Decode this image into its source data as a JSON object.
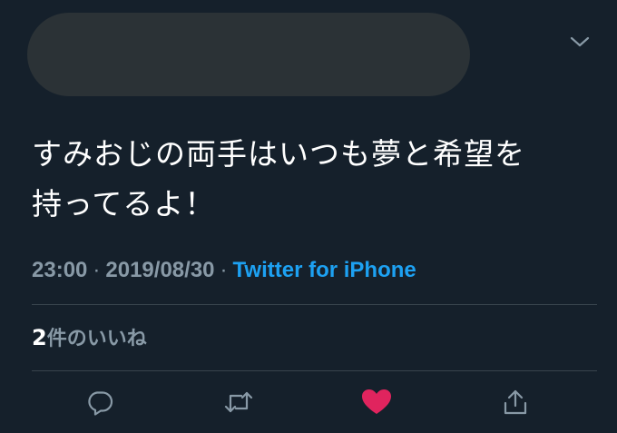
{
  "tweet": {
    "text_line1": "すみおじの両手はいつも夢と希望を",
    "text_line2": "持ってるよ！",
    "time": "23:00",
    "separator": "·",
    "date": "2019/08/30",
    "source": "Twitter for iPhone"
  },
  "stats": {
    "likes_count": "2",
    "likes_label": "件のいいね"
  },
  "actions": {
    "reply_icon": "reply-icon",
    "retweet_icon": "retweet-icon",
    "like_icon": "heart-icon",
    "share_icon": "share-icon",
    "liked": true
  },
  "colors": {
    "background": "#15202b",
    "text": "#ffffff",
    "muted": "#8899a6",
    "link": "#1da1f2",
    "like": "#e0245e",
    "divider": "#38444d",
    "redacted": "#2b3236"
  }
}
